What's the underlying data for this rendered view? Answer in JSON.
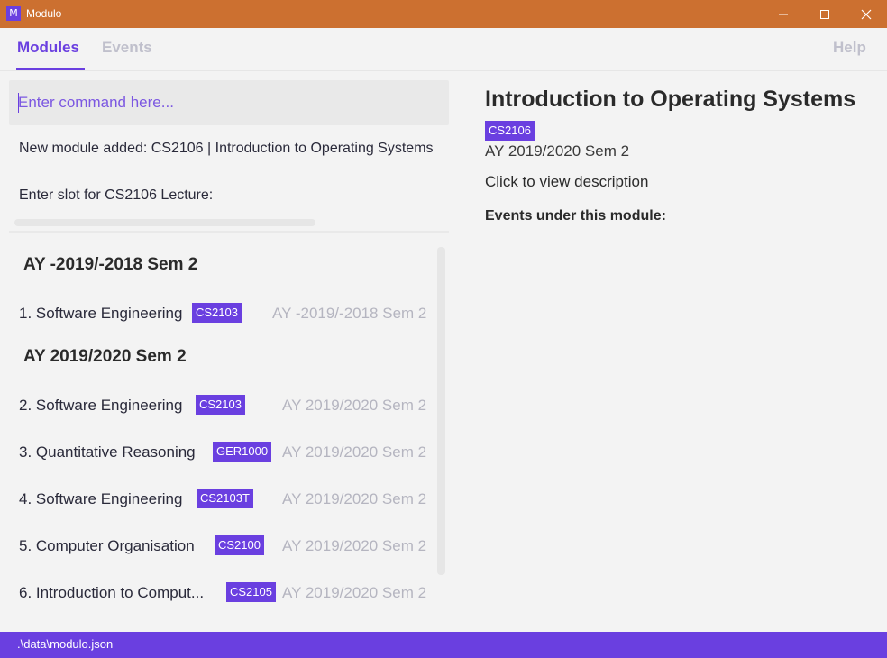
{
  "window": {
    "title": "Modulo",
    "icon_letter": "M"
  },
  "colors": {
    "accent": "#6a3fe0",
    "titlebar": "#cc7030",
    "muted": "#b5b5c0"
  },
  "tabs": {
    "modules": "Modules",
    "events": "Events",
    "help": "Help"
  },
  "command": {
    "placeholder": "Enter command here...",
    "value": ""
  },
  "result": {
    "line1": "New module added: CS2106 | Introduction to Operating Systems",
    "line2": "Enter slot for CS2106 Lecture:"
  },
  "groups": [
    {
      "header": "AY -2019/-2018 Sem 2",
      "modules": [
        {
          "name": "1. Software Engineering",
          "code": "CS2103",
          "sem": "AY -2019/-2018 Sem 2"
        }
      ]
    },
    {
      "header": "AY 2019/2020 Sem 2",
      "modules": [
        {
          "name": "2. Software Engineering",
          "code": "CS2103",
          "sem": "AY 2019/2020 Sem 2"
        },
        {
          "name": "3. Quantitative Reasoning",
          "code": "GER1000",
          "sem": "AY 2019/2020 Sem 2"
        },
        {
          "name": "4. Software Engineering",
          "code": "CS2103T",
          "sem": "AY 2019/2020 Sem 2"
        },
        {
          "name": "5. Computer Organisation",
          "code": "CS2100",
          "sem": "AY 2019/2020 Sem 2"
        },
        {
          "name": "6. Introduction to Comput...",
          "code": "CS2105",
          "sem": "AY 2019/2020 Sem 2"
        }
      ]
    }
  ],
  "detail": {
    "title": "Introduction to Operating Systems",
    "code": "CS2106",
    "sem": "AY 2019/2020 Sem 2",
    "description_link": "Click to view description",
    "events_header": "Events under this module:"
  },
  "status": {
    "path": ".\\data\\modulo.json"
  }
}
